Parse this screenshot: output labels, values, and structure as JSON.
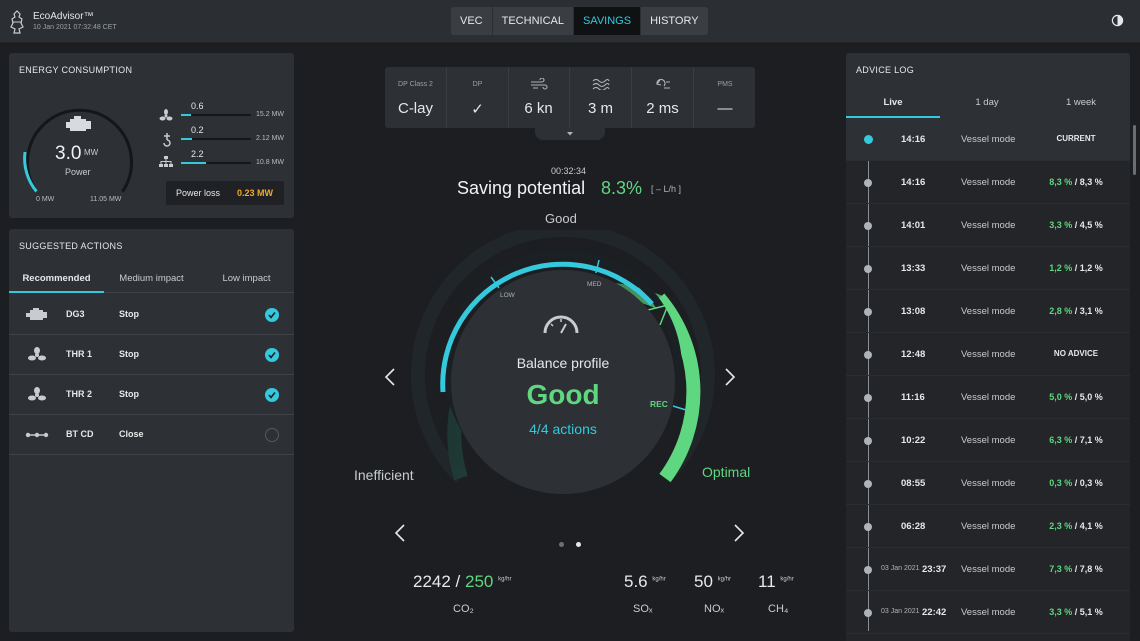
{
  "header": {
    "app_name": "EcoAdvisor™",
    "datetime": "10 Jan 2021  07:32:48 CET",
    "tabs": [
      {
        "label": "VEC",
        "active": false
      },
      {
        "label": "TECHNICAL",
        "active": false
      },
      {
        "label": "SAVINGS",
        "active": true
      },
      {
        "label": "HISTORY",
        "active": false
      }
    ]
  },
  "energy": {
    "title": "ENERGY CONSUMPTION",
    "power_value": "3.0",
    "power_unit": "MW",
    "power_label": "Power",
    "scale_min": "0 MW",
    "scale_max": "11.05 MW",
    "gauge_fraction": 0.27,
    "bars": [
      {
        "icon": "propeller-icon",
        "value": "0.6",
        "max": "15.2 MW",
        "fraction": 0.04
      },
      {
        "icon": "hook-icon",
        "value": "0.2",
        "max": "2.12 MW",
        "fraction": 0.09
      },
      {
        "icon": "network-icon",
        "value": "2.2",
        "max": "10.8 MW",
        "fraction": 0.2
      }
    ],
    "power_loss_label": "Power loss",
    "power_loss_value": "0.23 MW"
  },
  "actions": {
    "title": "SUGGESTED ACTIONS",
    "tabs": [
      "Recommended",
      "Medium impact",
      "Low impact"
    ],
    "items": [
      {
        "icon": "engine-icon",
        "name": "DG3",
        "action": "Stop",
        "checked": true
      },
      {
        "icon": "propeller-icon",
        "name": "THR 1",
        "action": "Stop",
        "checked": true
      },
      {
        "icon": "propeller-icon",
        "name": "THR 2",
        "action": "Stop",
        "checked": true
      },
      {
        "icon": "bow-thruster-icon",
        "name": "BT CD",
        "action": "Close",
        "checked": false
      }
    ]
  },
  "conditions": [
    {
      "label": "DP Class 2",
      "value": "C-lay",
      "icon": ""
    },
    {
      "label": "DP",
      "value": "✓",
      "icon": ""
    },
    {
      "label": "",
      "value": "6 kn",
      "icon": "wind-icon"
    },
    {
      "label": "",
      "value": "3 m",
      "icon": "waves-icon"
    },
    {
      "label": "",
      "value": "2 ms",
      "icon": "current-icon"
    },
    {
      "label": "PMS",
      "value": "—",
      "icon": ""
    }
  ],
  "saving": {
    "timer": "00:32:34",
    "label": "Saving potential",
    "value": "8.3%",
    "unit": "[ – L/h ]",
    "top_label": "Good",
    "low_label": "LOW",
    "med_label": "MED",
    "rec_label": "REC",
    "left_label": "Inefficient",
    "right_label": "Optimal",
    "profile_title": "Balance profile",
    "profile_status": "Good",
    "profile_actions": "4/4 actions"
  },
  "emissions": {
    "co2_current": "2242",
    "co2_target": "250",
    "co2_unit": "kg/hr",
    "co2_label": "CO₂",
    "sox_value": "5.6",
    "sox_unit": "kg/hr",
    "sox_label": "SOₓ",
    "nox_value": "50",
    "nox_unit": "kg/hr",
    "nox_label": "NOₓ",
    "ch4_value": "11",
    "ch4_unit": "kg/hr",
    "ch4_label": "CH₄"
  },
  "advice_log": {
    "title": "ADVICE LOG",
    "tabs": [
      "Live",
      "1 day",
      "1 week"
    ],
    "entries": [
      {
        "date": "",
        "time": "14:16",
        "mode": "Vessel mode",
        "value": "CURRENT",
        "v1": "",
        "v2": "",
        "current": true
      },
      {
        "date": "",
        "time": "14:16",
        "mode": "Vessel mode",
        "value": "",
        "v1": "8,3 %",
        "v2": "8,3 %"
      },
      {
        "date": "",
        "time": "14:01",
        "mode": "Vessel mode",
        "value": "",
        "v1": "3,3 %",
        "v2": "4,5 %"
      },
      {
        "date": "",
        "time": "13:33",
        "mode": "Vessel mode",
        "value": "",
        "v1": "1,2 %",
        "v2": "1,2 %"
      },
      {
        "date": "",
        "time": "13:08",
        "mode": "Vessel mode",
        "value": "",
        "v1": "2,8 %",
        "v2": "3,1 %"
      },
      {
        "date": "",
        "time": "12:48",
        "mode": "Vessel mode",
        "value": "NO ADVICE",
        "v1": "",
        "v2": ""
      },
      {
        "date": "",
        "time": "11:16",
        "mode": "Vessel mode",
        "value": "",
        "v1": "5,0 %",
        "v2": "5,0 %"
      },
      {
        "date": "",
        "time": "10:22",
        "mode": "Vessel mode",
        "value": "",
        "v1": "6,3 %",
        "v2": "7,1 %"
      },
      {
        "date": "",
        "time": "08:55",
        "mode": "Vessel mode",
        "value": "",
        "v1": "0,3 %",
        "v2": "0,3 %"
      },
      {
        "date": "",
        "time": "06:28",
        "mode": "Vessel mode",
        "value": "",
        "v1": "2,3 %",
        "v2": "4,1 %"
      },
      {
        "date": "03 Jan 2021",
        "time": "23:37",
        "mode": "Vessel mode",
        "value": "",
        "v1": "7,3 %",
        "v2": "7,8 %"
      },
      {
        "date": "03 Jan 2021",
        "time": "22:42",
        "mode": "Vessel mode",
        "value": "",
        "v1": "3,3 %",
        "v2": "5,1 %"
      }
    ]
  },
  "colors": {
    "accent": "#35c9dd",
    "good": "#5fd680",
    "warning": "#f0a830"
  }
}
